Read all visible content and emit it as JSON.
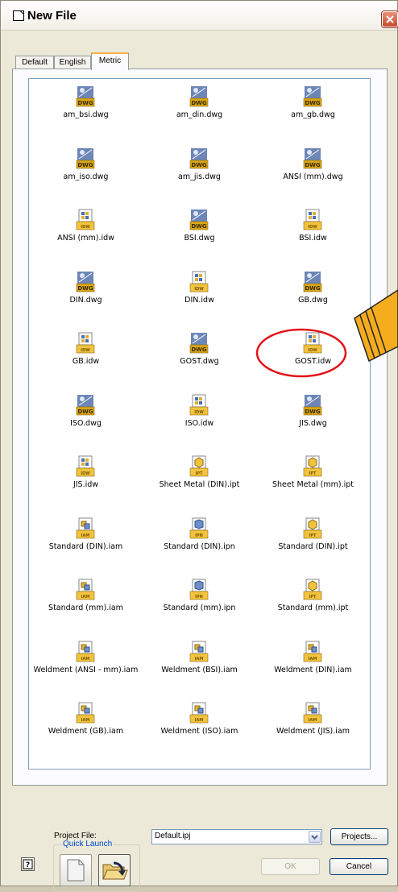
{
  "window": {
    "title": "New File"
  },
  "tabs": [
    {
      "label": "Default",
      "active": false
    },
    {
      "label": "English",
      "active": false
    },
    {
      "label": "Metric",
      "active": true
    }
  ],
  "files": [
    {
      "name": "am_bsi.dwg",
      "icon": "dwg-file-icon",
      "badge": "DWG"
    },
    {
      "name": "am_din.dwg",
      "icon": "dwg-file-icon",
      "badge": "DWG"
    },
    {
      "name": "am_gb.dwg",
      "icon": "dwg-file-icon",
      "badge": "DWG"
    },
    {
      "name": "am_iso.dwg",
      "icon": "dwg-file-icon",
      "badge": "DWG"
    },
    {
      "name": "am_jis.dwg",
      "icon": "dwg-file-icon",
      "badge": "DWG"
    },
    {
      "name": "ANSI (mm).dwg",
      "icon": "dwg-file-icon",
      "badge": "DWG"
    },
    {
      "name": "ANSI (mm).idw",
      "icon": "idw-file-icon",
      "badge": "IDW"
    },
    {
      "name": "BSI.dwg",
      "icon": "dwg-file-icon",
      "badge": "DWG"
    },
    {
      "name": "BSI.idw",
      "icon": "idw-file-icon",
      "badge": "IDW"
    },
    {
      "name": "DIN.dwg",
      "icon": "dwg-file-icon",
      "badge": "DWG"
    },
    {
      "name": "DIN.idw",
      "icon": "idw-file-icon",
      "badge": "IDW"
    },
    {
      "name": "GB.dwg",
      "icon": "dwg-file-icon",
      "badge": "DWG"
    },
    {
      "name": "GB.idw",
      "icon": "idw-file-icon",
      "badge": "IDW"
    },
    {
      "name": "GOST.dwg",
      "icon": "dwg-file-icon",
      "badge": "DWG"
    },
    {
      "name": "GOST.idw",
      "icon": "idw-file-icon",
      "badge": "IDW"
    },
    {
      "name": "ISO.dwg",
      "icon": "dwg-file-icon",
      "badge": "DWG"
    },
    {
      "name": "ISO.idw",
      "icon": "idw-file-icon",
      "badge": "IDW"
    },
    {
      "name": "JIS.dwg",
      "icon": "dwg-file-icon",
      "badge": "DWG"
    },
    {
      "name": "JIS.idw",
      "icon": "idw-file-icon",
      "badge": "IDW"
    },
    {
      "name": "Sheet Metal (DIN).ipt",
      "icon": "ipt-file-icon",
      "badge": "IPT"
    },
    {
      "name": "Sheet Metal (mm).ipt",
      "icon": "ipt-file-icon",
      "badge": "IPT"
    },
    {
      "name": "Standard (DIN).iam",
      "icon": "iam-file-icon",
      "badge": "IAM"
    },
    {
      "name": "Standard (DIN).ipn",
      "icon": "ipn-file-icon",
      "badge": "IPN"
    },
    {
      "name": "Standard (DIN).ipt",
      "icon": "ipt-file-icon",
      "badge": "IPT"
    },
    {
      "name": "Standard (mm).iam",
      "icon": "iam-file-icon",
      "badge": "IAM"
    },
    {
      "name": "Standard (mm).ipn",
      "icon": "ipn-file-icon",
      "badge": "IPN"
    },
    {
      "name": "Standard (mm).ipt",
      "icon": "ipt-file-icon",
      "badge": "IPT"
    },
    {
      "name": "Weldment (ANSI - mm).iam",
      "icon": "iam-file-icon",
      "badge": "IAM"
    },
    {
      "name": "Weldment (BSI).iam",
      "icon": "iam-file-icon",
      "badge": "IAM"
    },
    {
      "name": "Weldment (DIN).iam",
      "icon": "iam-file-icon",
      "badge": "IAM"
    },
    {
      "name": "Weldment (GB).iam",
      "icon": "iam-file-icon",
      "badge": "IAM"
    },
    {
      "name": "Weldment (ISO).iam",
      "icon": "iam-file-icon",
      "badge": "IAM"
    },
    {
      "name": "Weldment (JIS).iam",
      "icon": "iam-file-icon",
      "badge": "IAM"
    }
  ],
  "highlighted_file": "GOST.idw",
  "footer": {
    "project_label": "Project File:",
    "project_value": "Default.ipj",
    "projects_button": "Projects...",
    "quick_launch_label": "Quick Launch",
    "ok_button": "OK",
    "cancel_button": "Cancel",
    "help_symbol": "?"
  },
  "colors": {
    "annotation_red": "#e3141b",
    "pencil_orange": "#f5ad1f",
    "tab_accent": "#f5b24a",
    "dwg_badge": "#d9a616",
    "idw_badge": "#f2c33f"
  }
}
